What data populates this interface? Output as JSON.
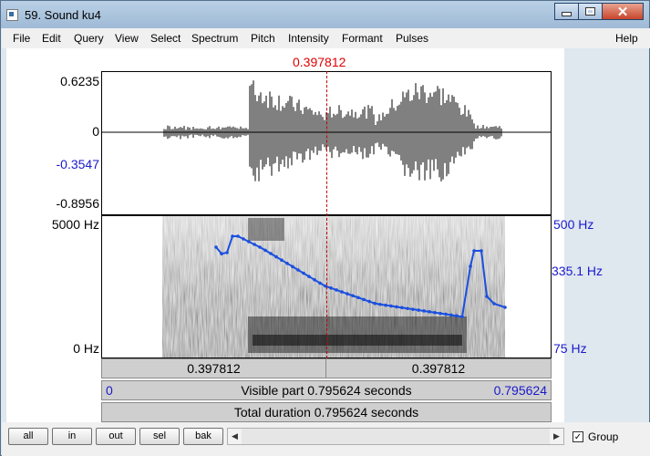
{
  "window": {
    "title": "59. Sound ku4"
  },
  "menu": [
    "File",
    "Edit",
    "Query",
    "View",
    "Select",
    "Spectrum",
    "Pitch",
    "Intensity",
    "Formant",
    "Pulses",
    "Help"
  ],
  "cursor_time": "0.397812",
  "waveform": {
    "y_top": "0.6235",
    "y_zero": "0",
    "y_cursor": "-0.3547",
    "y_bottom": "-0.8956"
  },
  "spectrogram": {
    "freq_top": "5000 Hz",
    "freq_bottom": "0 Hz",
    "pitch_top": "500 Hz",
    "pitch_cursor": "335.1 Hz",
    "pitch_bottom": "75 Hz"
  },
  "selection": {
    "left_duration": "0.397812",
    "right_duration": "0.397812"
  },
  "visible_part": {
    "start": "0",
    "label": "Visible part 0.795624 seconds",
    "end": "0.795624"
  },
  "total_duration": "Total duration 0.795624 seconds",
  "buttons": {
    "all": "all",
    "in": "in",
    "out": "out",
    "sel": "sel",
    "bak": "bak"
  },
  "group": {
    "label": "Group",
    "checked": true
  },
  "colors": {
    "cursor": "#e00000",
    "pitch": "#1a4fe0",
    "label_blue": "#1a1acc"
  }
}
